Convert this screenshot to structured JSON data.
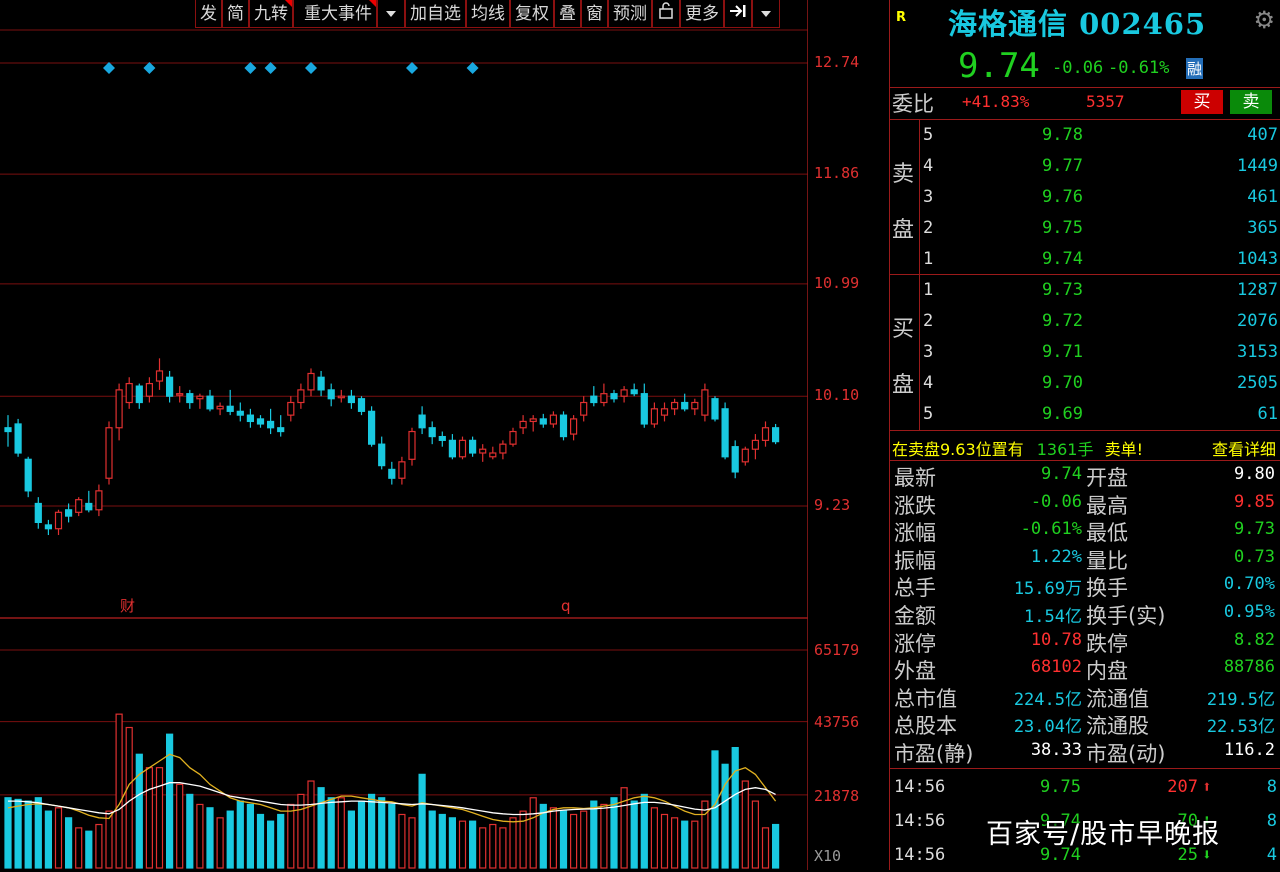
{
  "toolbar": {
    "buttons": [
      "发",
      "简",
      "九转",
      "重大事件",
      "加自选",
      "均线",
      "复权",
      "叠",
      "窗",
      "预测",
      "更多"
    ],
    "icons": [
      "chevron-down-icon",
      "lock-icon",
      "collapse-icon",
      "chevron-down-icon"
    ]
  },
  "price_axis": [
    "12.74",
    "11.86",
    "10.99",
    "10.10",
    "9.23"
  ],
  "volume_axis": [
    "65179",
    "43756",
    "21878",
    "X10"
  ],
  "chart_marks": {
    "cai": "财",
    "q": "q"
  },
  "colors": {
    "up": "#e03030",
    "down": "#19c9e0",
    "green": "#20d020",
    "yellow": "#ffff00",
    "grid": "#7a0f0f",
    "ma1": "#e0b020",
    "ma2": "#ffffff"
  },
  "chart_data": [
    {
      "type": "candlestick",
      "title": "",
      "ylim": [
        9.0,
        12.9
      ],
      "ticks": [
        12.74,
        11.86,
        10.99,
        10.1,
        9.23
      ],
      "candles": [
        {
          "o": 9.85,
          "h": 9.95,
          "l": 9.7,
          "c": 9.82
        },
        {
          "o": 9.88,
          "h": 9.92,
          "l": 9.62,
          "c": 9.65
        },
        {
          "o": 9.6,
          "h": 9.62,
          "l": 9.3,
          "c": 9.35
        },
        {
          "o": 9.25,
          "h": 9.3,
          "l": 9.05,
          "c": 9.1
        },
        {
          "o": 9.08,
          "h": 9.12,
          "l": 9.0,
          "c": 9.05
        },
        {
          "o": 9.05,
          "h": 9.2,
          "l": 9.0,
          "c": 9.18
        },
        {
          "o": 9.2,
          "h": 9.25,
          "l": 9.1,
          "c": 9.15
        },
        {
          "o": 9.18,
          "h": 9.3,
          "l": 9.15,
          "c": 9.28
        },
        {
          "o": 9.25,
          "h": 9.35,
          "l": 9.18,
          "c": 9.2
        },
        {
          "o": 9.2,
          "h": 9.4,
          "l": 9.15,
          "c": 9.35
        },
        {
          "o": 9.45,
          "h": 9.9,
          "l": 9.4,
          "c": 9.85
        },
        {
          "o": 9.85,
          "h": 10.2,
          "l": 9.75,
          "c": 10.15
        },
        {
          "o": 10.05,
          "h": 10.25,
          "l": 10.0,
          "c": 10.2
        },
        {
          "o": 10.18,
          "h": 10.2,
          "l": 10.0,
          "c": 10.05
        },
        {
          "o": 10.1,
          "h": 10.25,
          "l": 10.05,
          "c": 10.2
        },
        {
          "o": 10.22,
          "h": 10.4,
          "l": 10.15,
          "c": 10.3
        },
        {
          "o": 10.25,
          "h": 10.3,
          "l": 10.05,
          "c": 10.1
        },
        {
          "o": 10.12,
          "h": 10.18,
          "l": 10.05,
          "c": 10.12
        },
        {
          "o": 10.12,
          "h": 10.15,
          "l": 10.0,
          "c": 10.05
        },
        {
          "o": 10.08,
          "h": 10.12,
          "l": 10.0,
          "c": 10.1
        },
        {
          "o": 10.1,
          "h": 10.15,
          "l": 9.98,
          "c": 10.0
        },
        {
          "o": 10.0,
          "h": 10.05,
          "l": 9.95,
          "c": 10.02
        },
        {
          "o": 10.02,
          "h": 10.15,
          "l": 9.95,
          "c": 9.98
        },
        {
          "o": 9.98,
          "h": 10.05,
          "l": 9.9,
          "c": 9.95
        },
        {
          "o": 9.95,
          "h": 10.0,
          "l": 9.85,
          "c": 9.9
        },
        {
          "o": 9.92,
          "h": 9.95,
          "l": 9.85,
          "c": 9.88
        },
        {
          "o": 9.9,
          "h": 10.0,
          "l": 9.8,
          "c": 9.85
        },
        {
          "o": 9.85,
          "h": 9.95,
          "l": 9.78,
          "c": 9.82
        },
        {
          "o": 9.95,
          "h": 10.1,
          "l": 9.9,
          "c": 10.05
        },
        {
          "o": 10.05,
          "h": 10.2,
          "l": 10.0,
          "c": 10.15
        },
        {
          "o": 10.15,
          "h": 10.32,
          "l": 10.1,
          "c": 10.28
        },
        {
          "o": 10.25,
          "h": 10.3,
          "l": 10.1,
          "c": 10.15
        },
        {
          "o": 10.15,
          "h": 10.2,
          "l": 10.02,
          "c": 10.08
        },
        {
          "o": 10.1,
          "h": 10.15,
          "l": 10.05,
          "c": 10.1
        },
        {
          "o": 10.1,
          "h": 10.15,
          "l": 10.0,
          "c": 10.05
        },
        {
          "o": 10.08,
          "h": 10.1,
          "l": 9.95,
          "c": 9.98
        },
        {
          "o": 9.98,
          "h": 10.02,
          "l": 9.7,
          "c": 9.72
        },
        {
          "o": 9.72,
          "h": 9.78,
          "l": 9.52,
          "c": 9.55
        },
        {
          "o": 9.52,
          "h": 9.58,
          "l": 9.4,
          "c": 9.45
        },
        {
          "o": 9.45,
          "h": 9.62,
          "l": 9.4,
          "c": 9.58
        },
        {
          "o": 9.6,
          "h": 9.85,
          "l": 9.55,
          "c": 9.82
        },
        {
          "o": 9.95,
          "h": 10.02,
          "l": 9.8,
          "c": 9.85
        },
        {
          "o": 9.85,
          "h": 9.9,
          "l": 9.72,
          "c": 9.78
        },
        {
          "o": 9.78,
          "h": 9.82,
          "l": 9.7,
          "c": 9.75
        },
        {
          "o": 9.75,
          "h": 9.8,
          "l": 9.6,
          "c": 9.62
        },
        {
          "o": 9.62,
          "h": 9.78,
          "l": 9.6,
          "c": 9.75
        },
        {
          "o": 9.75,
          "h": 9.78,
          "l": 9.62,
          "c": 9.65
        },
        {
          "o": 9.65,
          "h": 9.72,
          "l": 9.58,
          "c": 9.68
        },
        {
          "o": 9.62,
          "h": 9.7,
          "l": 9.6,
          "c": 9.65
        },
        {
          "o": 9.65,
          "h": 9.75,
          "l": 9.6,
          "c": 9.72
        },
        {
          "o": 9.72,
          "h": 9.85,
          "l": 9.7,
          "c": 9.82
        },
        {
          "o": 9.85,
          "h": 9.95,
          "l": 9.8,
          "c": 9.9
        },
        {
          "o": 9.9,
          "h": 9.95,
          "l": 9.82,
          "c": 9.92
        },
        {
          "o": 9.92,
          "h": 9.96,
          "l": 9.85,
          "c": 9.88
        },
        {
          "o": 9.88,
          "h": 9.98,
          "l": 9.85,
          "c": 9.95
        },
        {
          "o": 9.95,
          "h": 9.98,
          "l": 9.75,
          "c": 9.78
        },
        {
          "o": 9.8,
          "h": 9.95,
          "l": 9.75,
          "c": 9.92
        },
        {
          "o": 9.95,
          "h": 10.1,
          "l": 9.9,
          "c": 10.05
        },
        {
          "o": 10.1,
          "h": 10.18,
          "l": 10.02,
          "c": 10.05
        },
        {
          "o": 10.05,
          "h": 10.2,
          "l": 10.02,
          "c": 10.12
        },
        {
          "o": 10.12,
          "h": 10.15,
          "l": 10.05,
          "c": 10.08
        },
        {
          "o": 10.1,
          "h": 10.18,
          "l": 10.05,
          "c": 10.15
        },
        {
          "o": 10.15,
          "h": 10.2,
          "l": 10.1,
          "c": 10.12
        },
        {
          "o": 10.12,
          "h": 10.2,
          "l": 9.85,
          "c": 9.88
        },
        {
          "o": 9.88,
          "h": 10.05,
          "l": 9.85,
          "c": 10.0
        },
        {
          "o": 9.95,
          "h": 10.05,
          "l": 9.9,
          "c": 10.0
        },
        {
          "o": 10.0,
          "h": 10.08,
          "l": 9.95,
          "c": 10.05
        },
        {
          "o": 10.05,
          "h": 10.12,
          "l": 9.98,
          "c": 10.0
        },
        {
          "o": 10.0,
          "h": 10.08,
          "l": 9.95,
          "c": 10.05
        },
        {
          "o": 9.95,
          "h": 10.2,
          "l": 9.9,
          "c": 10.15
        },
        {
          "o": 10.08,
          "h": 10.1,
          "l": 9.9,
          "c": 9.92
        },
        {
          "o": 10.0,
          "h": 10.05,
          "l": 9.6,
          "c": 9.62
        },
        {
          "o": 9.7,
          "h": 9.75,
          "l": 9.45,
          "c": 9.5
        },
        {
          "o": 9.58,
          "h": 9.7,
          "l": 9.55,
          "c": 9.68
        },
        {
          "o": 9.68,
          "h": 9.8,
          "l": 9.6,
          "c": 9.75
        },
        {
          "o": 9.75,
          "h": 9.9,
          "l": 9.7,
          "c": 9.85
        },
        {
          "o": 9.85,
          "h": 9.88,
          "l": 9.72,
          "c": 9.74
        }
      ],
      "event_markers_at": [
        10,
        14,
        24,
        26,
        30,
        40,
        46
      ]
    },
    {
      "type": "bar",
      "title": "",
      "ylim": [
        0,
        68000
      ],
      "ticks": [
        65179,
        43756,
        21878
      ],
      "values": [
        21000,
        20500,
        20000,
        21000,
        17000,
        18000,
        15000,
        12000,
        11000,
        13000,
        17000,
        46000,
        42000,
        34000,
        30000,
        30000,
        40000,
        25000,
        22000,
        19000,
        18000,
        15000,
        17000,
        20000,
        19000,
        16000,
        14000,
        16000,
        19000,
        22000,
        26000,
        24000,
        21000,
        21000,
        17000,
        20000,
        22000,
        21000,
        19000,
        16000,
        15000,
        28000,
        17000,
        16000,
        15000,
        14000,
        14000,
        12000,
        13000,
        12000,
        15000,
        17000,
        21000,
        19000,
        18000,
        17000,
        16000,
        17000,
        20000,
        19000,
        21000,
        24000,
        20000,
        22000,
        18000,
        16000,
        15000,
        14000,
        14000,
        20000,
        35000,
        31000,
        36000,
        26000,
        20000,
        12000,
        13000
      ],
      "ma1": [
        18000,
        18500,
        19000,
        19200,
        19000,
        18500,
        18000,
        17000,
        15800,
        15000,
        14800,
        19000,
        25000,
        28000,
        30000,
        32000,
        34000,
        33000,
        30000,
        28000,
        25000,
        23000,
        21000,
        20000,
        19500,
        19000,
        18000,
        17000,
        17000,
        17500,
        18500,
        19500,
        20500,
        21500,
        21500,
        21000,
        20500,
        20000,
        19800,
        19000,
        18500,
        19500,
        19000,
        18500,
        18000,
        17500,
        16500,
        15500,
        14500,
        14000,
        13800,
        14000,
        15000,
        16500,
        17500,
        18000,
        18000,
        17800,
        18000,
        18500,
        19000,
        20000,
        21000,
        21500,
        21000,
        20000,
        18500,
        17000,
        16000,
        16000,
        19000,
        25000,
        29000,
        30000,
        28000,
        24000,
        20000
      ],
      "ma2": [
        20000,
        20000,
        19800,
        19500,
        19000,
        18500,
        18000,
        17500,
        17000,
        16500,
        16200,
        17500,
        20000,
        22000,
        23500,
        24500,
        25500,
        25500,
        25000,
        24500,
        23500,
        22500,
        21500,
        21000,
        20500,
        20000,
        19500,
        19000,
        18800,
        18800,
        19000,
        19300,
        19600,
        19800,
        20000,
        20000,
        19800,
        19600,
        19400,
        19200,
        19000,
        19200,
        19000,
        18700,
        18400,
        18000,
        17500,
        17000,
        16500,
        16200,
        16000,
        16000,
        16200,
        16500,
        17000,
        17300,
        17500,
        17600,
        17700,
        17900,
        18200,
        18700,
        19200,
        19600,
        19600,
        19300,
        18800,
        18200,
        17600,
        17300,
        18000,
        20000,
        22000,
        23500,
        24000,
        23500,
        22000
      ]
    }
  ],
  "stock": {
    "badge": "R",
    "title": "海格通信 002465",
    "price": "9.74",
    "change": "-0.06",
    "change_pct": "-0.61%",
    "rong": "融"
  },
  "weibi": {
    "label": "委比",
    "pct": "+41.83%",
    "num": "5357",
    "buy": "买",
    "sell": "卖"
  },
  "book": {
    "sell_label": [
      "卖",
      "盘"
    ],
    "buy_label": [
      "买",
      "盘"
    ],
    "asks": [
      {
        "lvl": "5",
        "price": "9.78",
        "vol": "407"
      },
      {
        "lvl": "4",
        "price": "9.77",
        "vol": "1449"
      },
      {
        "lvl": "3",
        "price": "9.76",
        "vol": "461"
      },
      {
        "lvl": "2",
        "price": "9.75",
        "vol": "365"
      },
      {
        "lvl": "1",
        "price": "9.74",
        "vol": "1043"
      }
    ],
    "bids": [
      {
        "lvl": "1",
        "price": "9.73",
        "vol": "1287"
      },
      {
        "lvl": "2",
        "price": "9.72",
        "vol": "2076"
      },
      {
        "lvl": "3",
        "price": "9.71",
        "vol": "3153"
      },
      {
        "lvl": "4",
        "price": "9.70",
        "vol": "2505"
      },
      {
        "lvl": "5",
        "price": "9.69",
        "vol": "61"
      }
    ]
  },
  "notice": {
    "text1": "在卖盘9.63位置有",
    "text2": "1361手",
    "text3": "卖单!",
    "detail": "查看详细"
  },
  "stats": [
    {
      "l1": "最新",
      "v1": "9.74",
      "c1": "#20d020",
      "l2": "开盘",
      "v2": "9.80",
      "c2": "#ffffff"
    },
    {
      "l1": "涨跌",
      "v1": "-0.06",
      "c1": "#20d020",
      "l2": "最高",
      "v2": "9.85",
      "c2": "#ff3030"
    },
    {
      "l1": "涨幅",
      "v1": "-0.61%",
      "c1": "#20d020",
      "l2": "最低",
      "v2": "9.73",
      "c2": "#20d020"
    },
    {
      "l1": "振幅",
      "v1": "1.22%",
      "c1": "#19c9e0",
      "l2": "量比",
      "v2": "0.73",
      "c2": "#20d020"
    },
    {
      "l1": "总手",
      "v1": "15.69万",
      "c1": "#19c9e0",
      "l2": "换手",
      "v2": "0.70%",
      "c2": "#19c9e0"
    },
    {
      "l1": "金额",
      "v1": "1.54亿",
      "c1": "#19c9e0",
      "l2": "换手(实)",
      "v2": "0.95%",
      "c2": "#19c9e0"
    },
    {
      "l1": "涨停",
      "v1": "10.78",
      "c1": "#ff3030",
      "l2": "跌停",
      "v2": "8.82",
      "c2": "#20d020"
    },
    {
      "l1": "外盘",
      "v1": "68102",
      "c1": "#ff3030",
      "l2": "内盘",
      "v2": "88786",
      "c2": "#20d020"
    },
    {
      "l1": "总市值",
      "v1": "224.5亿",
      "c1": "#19c9e0",
      "l2": "流通值",
      "v2": "219.5亿",
      "c2": "#19c9e0"
    },
    {
      "l1": "总股本",
      "v1": "23.04亿",
      "c1": "#19c9e0",
      "l2": "流通股",
      "v2": "22.53亿",
      "c2": "#19c9e0"
    },
    {
      "l1": "市盈(静)",
      "v1": "38.33",
      "c1": "#ffffff",
      "l2": "市盈(动)",
      "v2": "116.2",
      "c2": "#ffffff"
    }
  ],
  "trades": [
    {
      "time": "14:56",
      "price": "9.75",
      "vol": "207",
      "vcolor": "#ff3030",
      "arrow": "up-arrow-icon",
      "n": "8"
    },
    {
      "time": "14:56",
      "price": "9.74",
      "vol": "70",
      "vcolor": "#20d020",
      "arrow": "down-arrow-icon",
      "n": "8"
    },
    {
      "time": "14:56",
      "price": "9.74",
      "vol": "25",
      "vcolor": "#20d020",
      "arrow": "down-arrow-icon",
      "n": "4"
    }
  ],
  "watermark": "百家号/股市早晚报"
}
